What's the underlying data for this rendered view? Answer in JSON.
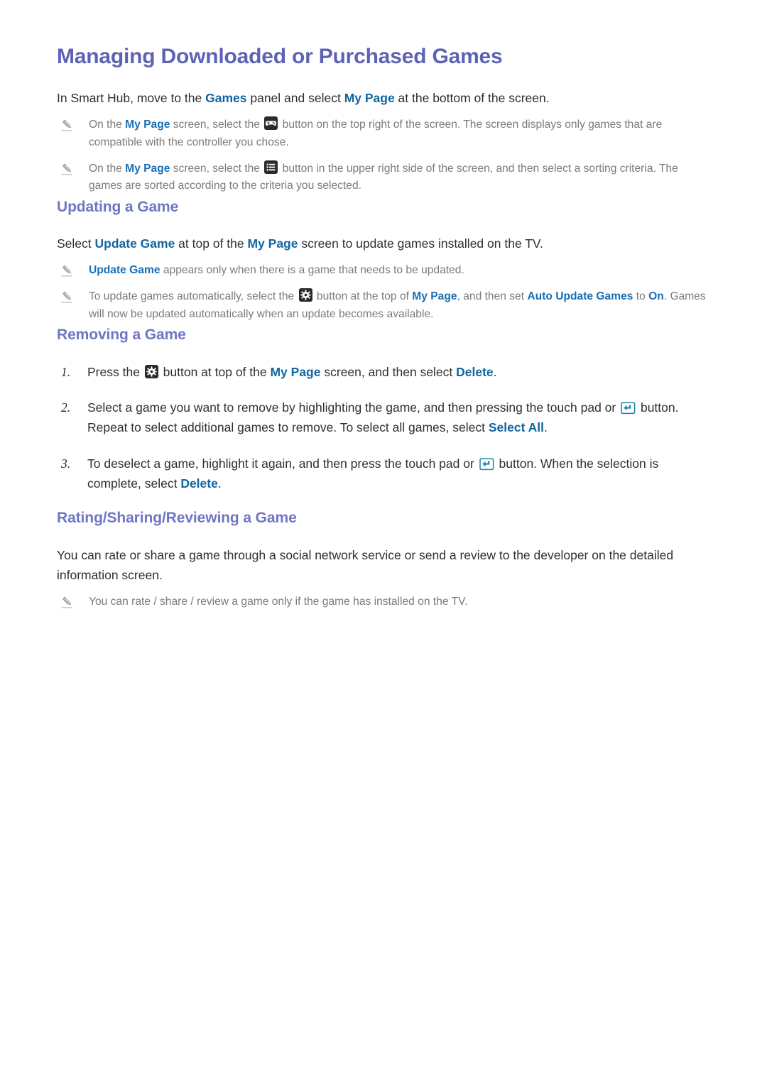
{
  "document": {
    "title": "Managing Downloaded or Purchased Games",
    "intro": {
      "pre": "In Smart Hub, move to the ",
      "link1": "Games",
      "mid": " panel and select ",
      "link2": "My Page",
      "post": " at the bottom of the screen."
    },
    "intro_notes": [
      {
        "icon": "pencil-icon",
        "inline_icon": "gamepad-icon",
        "pre": "On the ",
        "link1": "My Page",
        "mid": " screen, select the ",
        "post": " button on the top right of the screen. The screen displays only games that are compatible with the controller you chose."
      },
      {
        "icon": "pencil-icon",
        "inline_icon": "list-sort-icon",
        "pre": "On the ",
        "link1": "My Page",
        "mid": " screen, select the ",
        "post": " button in the upper right side of the screen, and then select a sorting criteria. The games are sorted according to the criteria you selected."
      }
    ],
    "sections": [
      {
        "id": "updating-a-game",
        "heading": "Updating a Game",
        "paragraph": {
          "pre": "Select ",
          "link1": "Update Game",
          "mid": " at top of the ",
          "link2": "My Page",
          "post": " screen to update games installed on the TV."
        },
        "notes": [
          {
            "icon": "pencil-icon",
            "link1": "Update Game",
            "post": " appears only when there is a game that needs to be updated."
          },
          {
            "icon": "pencil-icon",
            "inline_icon": "gear-icon",
            "pre": "To update games automatically, select the ",
            "mid": " button at the top of ",
            "link1": "My Page",
            "mid2": ", and then set ",
            "link2": "Auto Update Games",
            "mid3": " to ",
            "link3": "On",
            "post": ". Games will now be updated automatically when an update becomes available."
          }
        ]
      },
      {
        "id": "removing-a-game",
        "heading": "Removing a Game",
        "steps": [
          {
            "number": "1.",
            "inline_icon": "gear-icon",
            "pre": "Press the ",
            "mid": " button at top of the ",
            "link1": "My Page",
            "mid2": " screen, and then select ",
            "link2": "Delete",
            "post": "."
          },
          {
            "number": "2.",
            "inline_icon": "enter-key-icon",
            "pre": "Select a game you want to remove by highlighting the game, and then pressing the touch pad or ",
            "mid": " button. Repeat to select additional games to remove. To select all games, select ",
            "link1": "Select All",
            "post": "."
          },
          {
            "number": "3.",
            "inline_icon": "enter-key-icon",
            "pre": "To deselect a game, highlight it again, and then press the touch pad or ",
            "mid": " button. When the selection is complete, select ",
            "link1": "Delete",
            "post": "."
          }
        ]
      },
      {
        "id": "rating-sharing-reviewing-a-game",
        "heading": "Rating/Sharing/Reviewing a Game",
        "paragraph": {
          "text": "You can rate or share a game through a social network service or send a review to the developer on the detailed information screen."
        },
        "notes": [
          {
            "icon": "pencil-icon",
            "text": "You can rate / share / review a game only if the game has installed on the TV."
          }
        ]
      }
    ]
  },
  "colors": {
    "title": "#5d63b4",
    "section_heading": "#6f76c2",
    "link": "#10669f",
    "note_text": "#7b7b7b",
    "body_text": "#2f2f2f",
    "chip_bg": "#2b2b2b",
    "enter_key": "#1b85a6"
  }
}
